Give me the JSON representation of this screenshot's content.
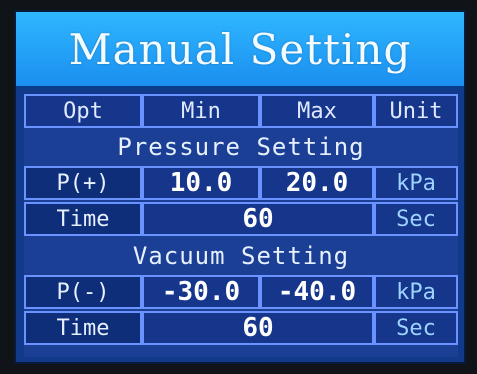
{
  "title": "Manual Setting",
  "header": {
    "opt": "Opt",
    "min": "Min",
    "max": "Max",
    "unit": "Unit"
  },
  "pressure": {
    "section_title": "Pressure Setting",
    "row": {
      "label": "P(+)",
      "min": "10.0",
      "max": "20.0",
      "unit": "kPa"
    },
    "time": {
      "label": "Time",
      "value": "60",
      "unit": "Sec"
    }
  },
  "vacuum": {
    "section_title": "Vacuum Setting",
    "row": {
      "label": "P(-)",
      "min": "-30.0",
      "max": "-40.0",
      "unit": "kPa"
    },
    "time": {
      "label": "Time",
      "value": "60",
      "unit": "Sec"
    }
  }
}
